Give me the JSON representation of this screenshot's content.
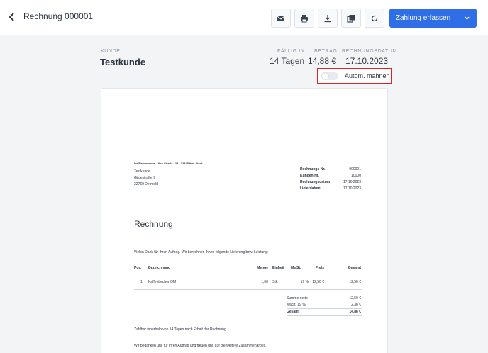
{
  "header": {
    "title": "Rechnung 000001",
    "primary_button": "Zahlung erfassen"
  },
  "info": {
    "kunde_label": "KUNDE",
    "kunde_value": "Testkunde",
    "faellig_label": "FÄLLIG IN",
    "faellig_value": "14 Tagen",
    "betrag_label": "BETRAG",
    "betrag_value": "14,88 €",
    "datum_label": "RECHNUNGSDATUM",
    "datum_value": "17.10.2023",
    "mahnen_label": "Autom. mahnen"
  },
  "doc": {
    "sender_line": "Ihr Firmenname - Ihre Straße 123 - 12345 Ihre Stadt",
    "address": [
      "Testkunde",
      "Gildestraße 9",
      "32760 Detmold"
    ],
    "meta": [
      {
        "label": "Rechnungs-Nr.",
        "value": "000001"
      },
      {
        "label": "Kunden-Nr.",
        "value": "10000"
      },
      {
        "label": "Rechnungsdatum",
        "value": "17.10.2023"
      },
      {
        "label": "Lieferdatum",
        "value": "17.10.2023"
      }
    ],
    "title": "Rechnung",
    "intro": "Vielen Dank für Ihren Auftrag. Wir berechnen Ihnen folgende Lieferung bzw. Leistung:",
    "columns": {
      "pos": "Pos.",
      "bezeichnung": "Bezeichnung",
      "menge": "Menge",
      "einheit": "Einheit",
      "mwst": "MwSt.",
      "preis": "Preis",
      "gesamt": "Gesamt"
    },
    "row": {
      "pos": "1.",
      "bezeichnung": "Kaffeebecher OM",
      "menge": "1,00",
      "einheit": "Stk.",
      "mwst": "19 %",
      "preis": "12,50 €",
      "gesamt": "12,50 €"
    },
    "totals": [
      {
        "label": "Summe netto",
        "value": "12,50 €"
      },
      {
        "label": "MwSt. 19 %",
        "value": "2,38 €"
      },
      {
        "label": "Gesamt",
        "value": "14,88 €"
      }
    ],
    "footer1": "Zahlbar innerhalb von 14 Tagen nach Erhalt der Rechnung.",
    "footer2": "Wir bedanken uns für Ihren Auftrag und freuen uns auf die weitere Zusammenarbeit."
  },
  "icons": [
    "back-icon",
    "mail-icon",
    "print-icon",
    "download-icon",
    "copy-icon",
    "refresh-icon",
    "chevron-down-icon"
  ]
}
